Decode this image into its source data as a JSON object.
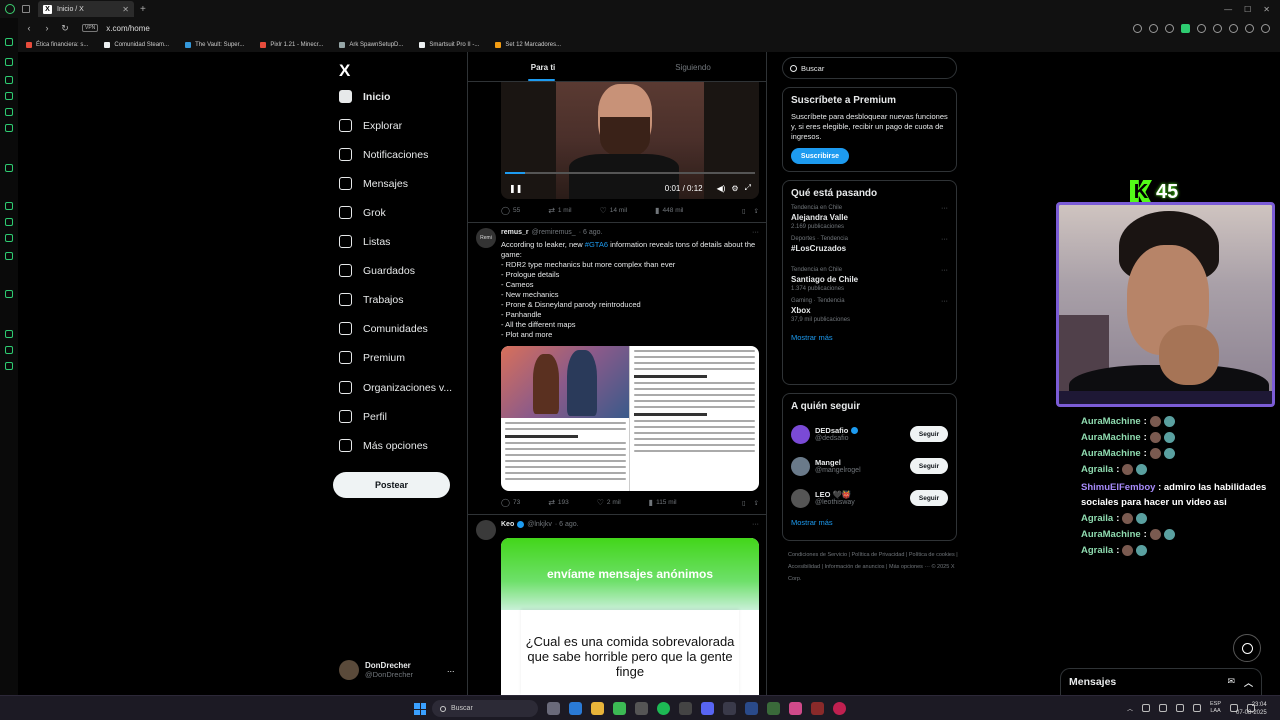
{
  "browser": {
    "tab_title": "Inicio / X",
    "url": "x.com/home",
    "vpn_label": "VPN",
    "bookmarks": [
      {
        "label": "Ética financiera: s...",
        "color": "#e74c3c"
      },
      {
        "label": "Comunidad Steam...",
        "color": "#ecf0f1"
      },
      {
        "label": "The Vault: Super...",
        "color": "#3498db"
      },
      {
        "label": "Pixlr 1.21 - Minecr...",
        "color": "#e74c3c"
      },
      {
        "label": "Ark SpawnSetupD...",
        "color": "#95a5a6"
      },
      {
        "label": "Smartsuit Pro II -...",
        "color": "#ecf0f1"
      },
      {
        "label": "Set 12 Marcadores...",
        "color": "#f39c12"
      }
    ]
  },
  "nav": {
    "logo": "X",
    "items": [
      {
        "label": "Inicio",
        "icon": "home-icon",
        "active": true
      },
      {
        "label": "Explorar",
        "icon": "search-icon"
      },
      {
        "label": "Notificaciones",
        "icon": "bell-icon"
      },
      {
        "label": "Mensajes",
        "icon": "envelope-icon"
      },
      {
        "label": "Grok",
        "icon": "grok-icon"
      },
      {
        "label": "Listas",
        "icon": "list-icon"
      },
      {
        "label": "Guardados",
        "icon": "bookmark-icon"
      },
      {
        "label": "Trabajos",
        "icon": "briefcase-icon"
      },
      {
        "label": "Comunidades",
        "icon": "people-icon"
      },
      {
        "label": "Premium",
        "icon": "x-icon"
      },
      {
        "label": "Organizaciones v...",
        "icon": "lightning-icon"
      },
      {
        "label": "Perfil",
        "icon": "person-icon"
      },
      {
        "label": "Más opciones",
        "icon": "more-circle-icon"
      }
    ],
    "post_button": "Postear",
    "account": {
      "name": "DonDrecher",
      "handle": "@DonDrecher",
      "more": "..."
    }
  },
  "feed": {
    "tabs": [
      {
        "label": "Para ti",
        "active": true
      },
      {
        "label": "Siguiendo"
      }
    ],
    "video": {
      "time": "0:01 / 0:12",
      "progress": 0.08
    },
    "video_actions": {
      "replies": "55",
      "reposts": "1 mil",
      "likes": "14 mil",
      "views": "448 mil"
    },
    "tweet1": {
      "avatar": "Remi",
      "name": "remus_r",
      "handle": "@remiremus_",
      "date": "· 6 ago.",
      "intro_before": "According to leaker, new ",
      "hashtag": "#GTA6",
      "intro_after": " information reveals tons of details about the game:",
      "lines": [
        "- RDR2 type mechanics but more complex than ever",
        "- Prologue details",
        "- Cameos",
        "- New mechanics",
        "- Prone & Disneyland parody reintroduced",
        "- Panhandle",
        "- All the different maps",
        "- Plot and more"
      ],
      "actions": {
        "replies": "73",
        "reposts": "193",
        "likes": "2 mil",
        "views": "115 mil"
      }
    },
    "tweet2": {
      "name": "Keo",
      "handle": "@lnkjkv",
      "date": "· 6 ago.",
      "card_title": "envíame mensajes anónimos",
      "card_question": "¿Cual es una comida sobrevalorada que sabe horrible pero que la gente finge"
    }
  },
  "right": {
    "search_placeholder": "Buscar",
    "premium": {
      "title": "Suscríbete a Premium",
      "desc": "Suscríbete para desbloquear nuevas funciones y, si eres elegible, recibir un pago de cuota de ingresos.",
      "button": "Suscribirse"
    },
    "trends": {
      "title": "Qué está pasando",
      "items": [
        {
          "context": "Tendencia en Chile",
          "name": "Alejandra Valle",
          "count": "2.169 publicaciones"
        },
        {
          "context": "Deportes · Tendencia",
          "name": "#LosCruzados",
          "count": ""
        },
        {
          "context": "Tendencia en Chile",
          "name": "Santiago de Chile",
          "count": "1.374 publicaciones"
        },
        {
          "context": "Gaming · Tendencia",
          "name": "Xbox",
          "count": "37,9 mil publicaciones"
        }
      ],
      "show_more": "Mostrar más"
    },
    "who_to_follow": {
      "title": "A quién seguir",
      "items": [
        {
          "name": "DEDsafio",
          "handle": "@dedsafio",
          "verified": true,
          "button": "Seguir",
          "color": "#7a4ad6"
        },
        {
          "name": "Mangel",
          "handle": "@mangelrogel",
          "verified": false,
          "button": "Seguir",
          "color": "#6a7a8a"
        },
        {
          "name": "LEO 🖤👹",
          "handle": "@leothisway",
          "verified": false,
          "button": "Seguir",
          "color": "#555555"
        }
      ],
      "show_more": "Mostrar más"
    },
    "footer": "Condiciones de Servicio | Política de Privacidad | Política de cookies | Accesibilidad | Información de anuncios | Más opciones ··· © 2025 X Corp."
  },
  "stream": {
    "badge_letter": "K",
    "badge_number": "45",
    "chat": [
      {
        "user": "AuraMachine",
        "text": " :",
        "emotes": true
      },
      {
        "user": "AuraMachine",
        "text": " :",
        "emotes": true
      },
      {
        "user": "AuraMachine",
        "text": " :",
        "emotes": true
      },
      {
        "user": "Agraila",
        "text": " :",
        "emotes": true
      }
    ],
    "chat_multi": {
      "user": "ShimuElFemboy",
      "text": " : admiro las habilidades sociales para hacer un video asi"
    },
    "chat_after": [
      {
        "user": "Agraila",
        "text": " :",
        "emotes": true
      },
      {
        "user": "AuraMachine",
        "text": " :",
        "emotes": true
      },
      {
        "user": "Agraila",
        "text": " :",
        "emotes": true
      }
    ]
  },
  "messages_drawer": {
    "title": "Mensajes"
  },
  "taskbar": {
    "search": "Buscar",
    "lang_top": "ESP",
    "lang_bottom": "LAA",
    "time": "23:04",
    "date": "07-08-2025"
  }
}
